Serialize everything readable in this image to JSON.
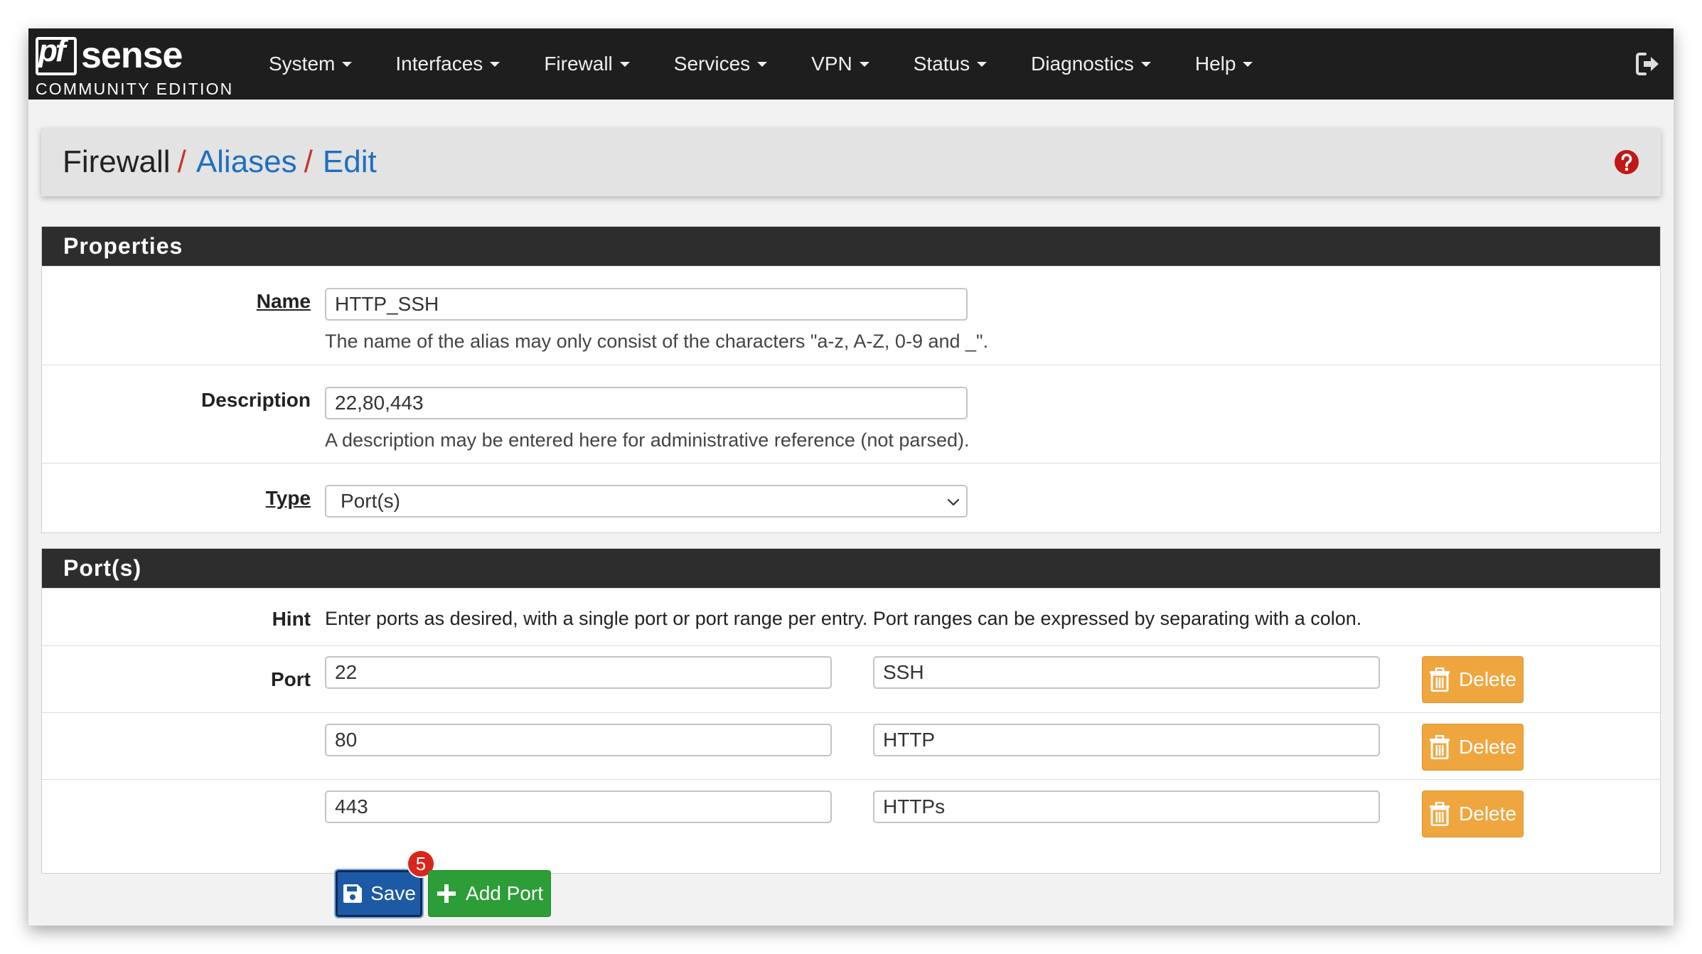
{
  "brand": {
    "logo_pf": "pf",
    "logo_sense": "sense",
    "edition": "COMMUNITY EDITION"
  },
  "nav": {
    "items": [
      {
        "label": "System"
      },
      {
        "label": "Interfaces"
      },
      {
        "label": "Firewall"
      },
      {
        "label": "Services"
      },
      {
        "label": "VPN"
      },
      {
        "label": "Status"
      },
      {
        "label": "Diagnostics"
      },
      {
        "label": "Help"
      }
    ],
    "logout_icon": "sign-out-icon"
  },
  "breadcrumb": {
    "root": "Firewall",
    "separator": "/",
    "level1": "Aliases",
    "level2": "Edit",
    "help_icon": "question-circle-icon"
  },
  "properties": {
    "heading": "Properties",
    "name_label": "Name",
    "name_value": "HTTP_SSH",
    "name_help": "The name of the alias may only consist of the characters \"a-z, A-Z, 0-9 and _\".",
    "description_label": "Description",
    "description_value": "22,80,443",
    "description_help": "A description may be entered here for administrative reference (not parsed).",
    "type_label": "Type",
    "type_value": "Port(s)"
  },
  "ports": {
    "heading": "Port(s)",
    "hint_label": "Hint",
    "hint_text": "Enter ports as desired, with a single port or port range per entry. Port ranges can be expressed by separating with a colon.",
    "port_label": "Port",
    "delete_label": "Delete",
    "entries": [
      {
        "port": "22",
        "description": "SSH"
      },
      {
        "port": "80",
        "description": "HTTP"
      },
      {
        "port": "443",
        "description": "HTTPs"
      }
    ]
  },
  "actions": {
    "save_label": "Save",
    "add_port_label": "Add Port",
    "badge": "5"
  },
  "colors": {
    "navbar": "#1e1e1e",
    "link": "#1e6fbf",
    "separator": "#c0392b",
    "delete": "#f0a63f",
    "save": "#1c5aa6",
    "add": "#2c9d37",
    "badge": "#d9261c"
  }
}
